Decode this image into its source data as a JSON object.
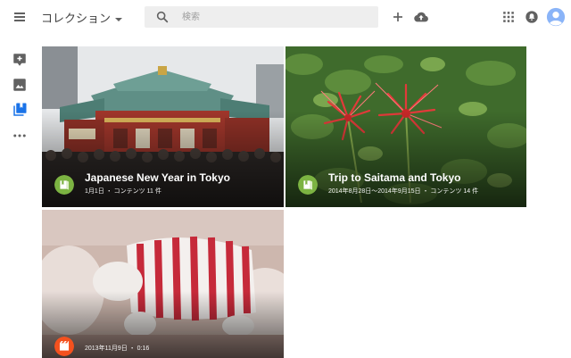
{
  "header": {
    "title": "コレクション",
    "search_placeholder": "検索",
    "icons": [
      "menu-icon",
      "caret-down-icon",
      "search-icon",
      "plus-icon",
      "cloud-upload-icon",
      "apps-grid-icon",
      "notifications-icon",
      "account-icon"
    ]
  },
  "sidebar": {
    "icons": [
      "add-comment-icon",
      "photo-icon",
      "collections-icon",
      "more-horizontal-icon"
    ],
    "active": "collections-icon"
  },
  "collections": [
    {
      "title": "Japanese New Year in Tokyo",
      "meta": "1月1日 ・ コンテンツ 11 件",
      "badge_icon": "album-icon",
      "badge_color": "#7cb342"
    },
    {
      "title": "Trip to Saitama and Tokyo",
      "meta": "2014年8月28日～2014年9月15日 ・ コンテンツ 14 件",
      "badge_icon": "album-icon",
      "badge_color": "#7cb342"
    },
    {
      "title": "",
      "meta": "2013年11月9日 ・ 0:16",
      "badge_icon": "movie-icon",
      "badge_color": "#f4511e"
    }
  ],
  "colors": {
    "accent": "#1a73e8",
    "icon_gray": "#616161",
    "search_bg": "#eeeeee"
  }
}
